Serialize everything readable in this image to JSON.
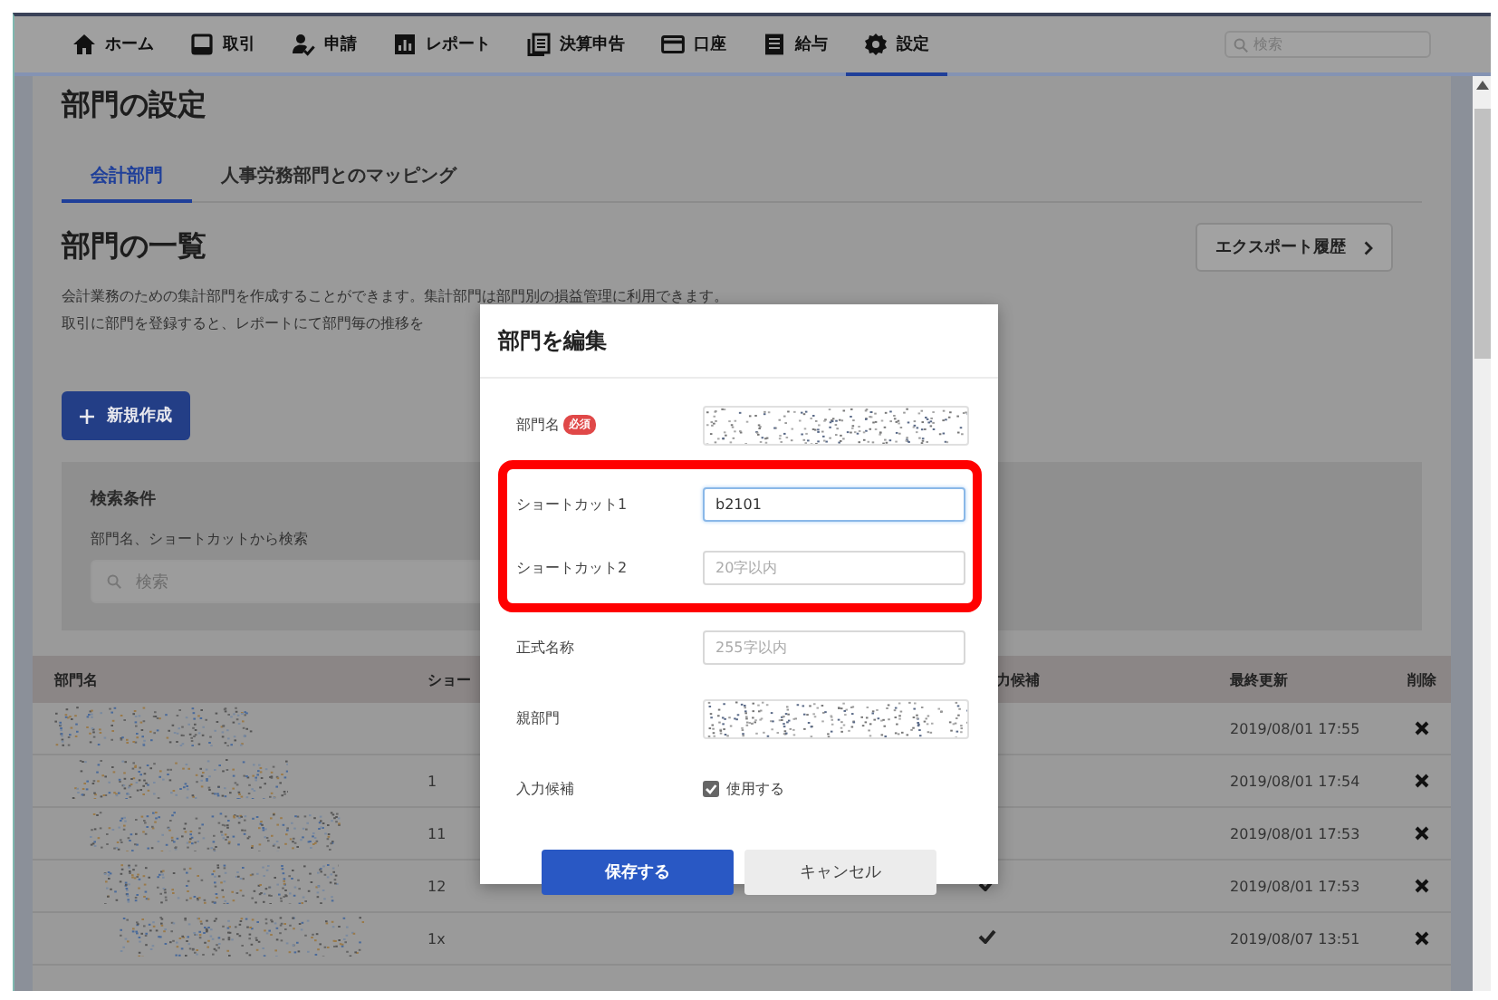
{
  "nav": {
    "items": [
      {
        "label": "ホーム",
        "selected": false
      },
      {
        "label": "取引",
        "selected": false
      },
      {
        "label": "申請",
        "selected": false
      },
      {
        "label": "レポート",
        "selected": false
      },
      {
        "label": "決算申告",
        "selected": false
      },
      {
        "label": "口座",
        "selected": false
      },
      {
        "label": "給与",
        "selected": false
      },
      {
        "label": "設定",
        "selected": true
      }
    ],
    "search": {
      "placeholder": "検索"
    }
  },
  "page": {
    "title": "部門の設定",
    "tabs": [
      {
        "label": "会計部門",
        "selected": true
      },
      {
        "label": "人事労務部門とのマッピング",
        "selected": false
      }
    ],
    "section_title": "部門の一覧",
    "export_button": "エクスポート履歴",
    "description": [
      "会計業務のための集計部門を作成することができます。集計部門は部門別の損益管理に利用できます。",
      "取引に部門を登録すると、レポートにて部門毎の推移を"
    ],
    "new_button": "新規作成",
    "search_panel": {
      "title": "検索条件",
      "label": "部門名、ショートカットから検索",
      "placeholder": "検索"
    }
  },
  "table": {
    "columns": [
      "部門名",
      "ショー",
      "力候補",
      "最終更新",
      "削除"
    ],
    "rows": [
      {
        "redacted": true,
        "updated": "2019/08/01 17:55"
      },
      {
        "redacted": true,
        "shortcut": "1",
        "updated": "2019/08/01 17:54"
      },
      {
        "redacted": true,
        "shortcut": "11",
        "updated": "2019/08/01 17:53"
      },
      {
        "redacted": true,
        "shortcut": "12",
        "candidate": true,
        "updated": "2019/08/01 17:53"
      },
      {
        "redacted": true,
        "shortcut": "1x",
        "candidate": true,
        "updated": "2019/08/07 13:51"
      }
    ]
  },
  "modal": {
    "title": "部門を編集",
    "fields": [
      {
        "kind": "input",
        "label": "部門名",
        "badge": "必須",
        "redacted": true,
        "highlighted": false
      },
      {
        "kind": "input",
        "label": "ショートカット1",
        "value": "b2101",
        "focused": true,
        "highlighted": true
      },
      {
        "kind": "input",
        "label": "ショートカット2",
        "placeholder": "20字以内",
        "focused": false,
        "highlighted": true
      },
      {
        "kind": "input",
        "label": "正式名称",
        "placeholder": "255字以内",
        "focused": false,
        "highlighted": false
      },
      {
        "kind": "input",
        "label": "親部門",
        "redacted": true,
        "highlighted": false
      },
      {
        "kind": "checkbox",
        "label": "入力候補",
        "text": "使用する",
        "checked": true,
        "highlighted": false
      }
    ],
    "buttons": [
      {
        "label": "保存する",
        "kind": "primary"
      },
      {
        "label": "キャンセル",
        "kind": "secondary"
      }
    ]
  }
}
